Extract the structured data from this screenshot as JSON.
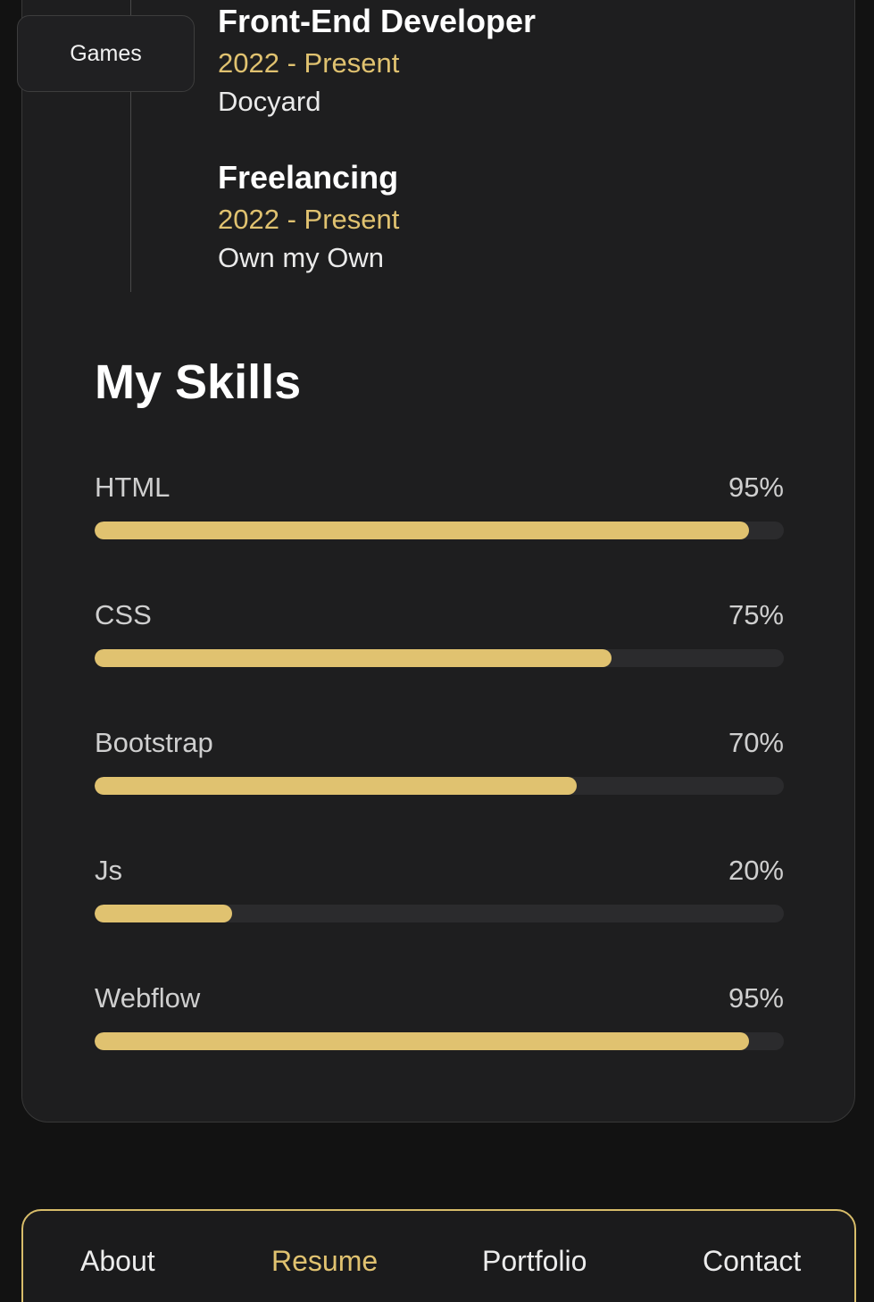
{
  "sidebar": {
    "games_label": "Games"
  },
  "timeline": [
    {
      "title": "Front-End Developer",
      "date": "2022 - Present",
      "company": "Docyard"
    },
    {
      "title": "Freelancing",
      "date": "2022 - Present",
      "company": "Own my Own"
    }
  ],
  "skills": {
    "title": "My Skills",
    "items": [
      {
        "name": "HTML",
        "percent_label": "95%",
        "value": 95
      },
      {
        "name": "CSS",
        "percent_label": "75%",
        "value": 75
      },
      {
        "name": "Bootstrap",
        "percent_label": "70%",
        "value": 70
      },
      {
        "name": "Js",
        "percent_label": "20%",
        "value": 20
      },
      {
        "name": "Webflow",
        "percent_label": "95%",
        "value": 95
      }
    ]
  },
  "nav": {
    "items": [
      {
        "label": "About"
      },
      {
        "label": "Resume"
      },
      {
        "label": "Portfolio"
      },
      {
        "label": "Contact"
      }
    ],
    "active": "Resume"
  },
  "colors": {
    "accent": "#e0c270",
    "background": "#121212",
    "card": "#1e1e1f"
  }
}
